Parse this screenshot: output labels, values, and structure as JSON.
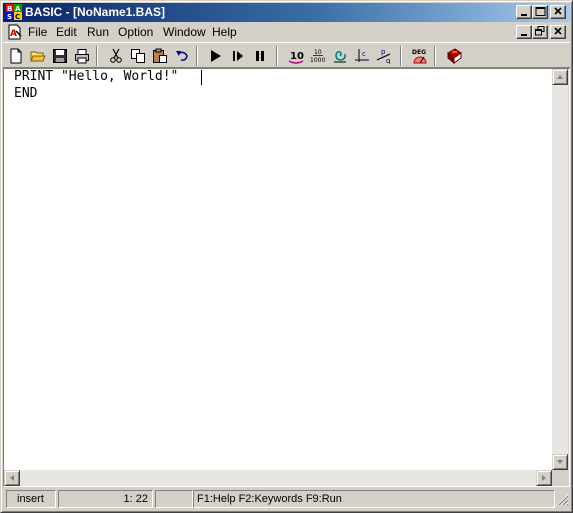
{
  "window": {
    "title": "BASIC - [NoName1.BAS]",
    "icon": "basic-app-icon",
    "controls": [
      "minimize",
      "maximize",
      "close"
    ]
  },
  "menu": {
    "doc_icon": "document-icon",
    "items": [
      "File",
      "Edit",
      "Run",
      "Option",
      "Window",
      "Help"
    ],
    "mdi_controls": [
      "minimize",
      "restore",
      "close"
    ]
  },
  "toolbar": {
    "buttons": [
      "new-file",
      "open-folder",
      "save",
      "print",
      "cut",
      "copy",
      "paste",
      "undo",
      "run",
      "step",
      "pause",
      "decimal-10",
      "hex-10-1000",
      "spiral",
      "integral-c",
      "pq-transform",
      "deg-mode",
      "help-book"
    ],
    "labels": {
      "dec": "10",
      "frac_top": "10",
      "frac_bottom": "1000",
      "deg": "DEG"
    }
  },
  "editor": {
    "lines": [
      "PRINT \"Hello, World!\"",
      "END"
    ]
  },
  "status": {
    "mode": "insert",
    "position": "1: 22",
    "hints": "F1:Help  F2:Keywords  F9:Run"
  },
  "colors": {
    "title_gradient_start": "#0a246a",
    "title_gradient_end": "#a6caf0",
    "chrome": "#d4d0c8"
  }
}
